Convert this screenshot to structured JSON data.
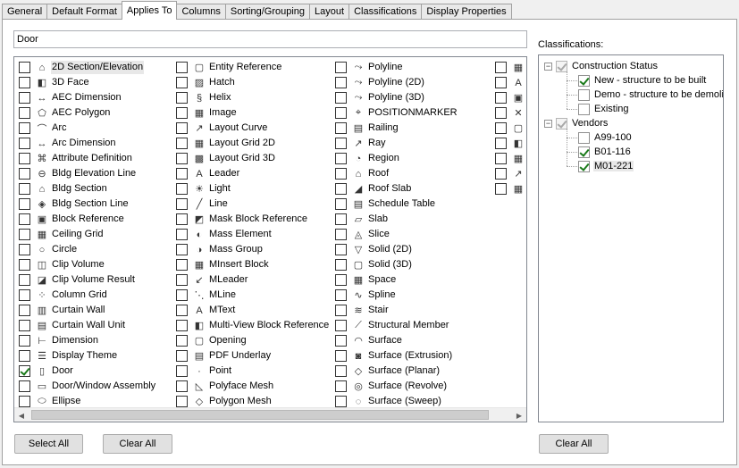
{
  "tabs": [
    "General",
    "Default Format",
    "Applies To",
    "Columns",
    "Sorting/Grouping",
    "Layout",
    "Classifications",
    "Display Properties"
  ],
  "active_tab": "Applies To",
  "filter": {
    "value": "Door"
  },
  "object_columns": [
    [
      {
        "label": "2D Section/Elevation",
        "icon": "section-elevation-icon",
        "checked": false,
        "selected": true
      },
      {
        "label": "3D Face",
        "icon": "face-icon",
        "checked": false
      },
      {
        "label": "AEC Dimension",
        "icon": "dimension-icon",
        "checked": false
      },
      {
        "label": "AEC Polygon",
        "icon": "polygon-icon",
        "checked": false
      },
      {
        "label": "Arc",
        "icon": "arc-icon",
        "checked": false
      },
      {
        "label": "Arc Dimension",
        "icon": "arc-dimension-icon",
        "checked": false
      },
      {
        "label": "Attribute Definition",
        "icon": "attribute-icon",
        "checked": false
      },
      {
        "label": "Bldg Elevation Line",
        "icon": "elevation-line-icon",
        "checked": false
      },
      {
        "label": "Bldg Section",
        "icon": "bldg-section-icon",
        "checked": false
      },
      {
        "label": "Bldg Section Line",
        "icon": "section-line-icon",
        "checked": false
      },
      {
        "label": "Block Reference",
        "icon": "block-icon",
        "checked": false
      },
      {
        "label": "Ceiling Grid",
        "icon": "ceiling-grid-icon",
        "checked": false
      },
      {
        "label": "Circle",
        "icon": "circle-icon",
        "checked": false
      },
      {
        "label": "Clip Volume",
        "icon": "clip-volume-icon",
        "checked": false
      },
      {
        "label": "Clip Volume Result",
        "icon": "clip-result-icon",
        "checked": false
      },
      {
        "label": "Column Grid",
        "icon": "column-grid-icon",
        "checked": false
      },
      {
        "label": "Curtain Wall",
        "icon": "curtain-wall-icon",
        "checked": false
      },
      {
        "label": "Curtain Wall Unit",
        "icon": "curtain-unit-icon",
        "checked": false
      },
      {
        "label": "Dimension",
        "icon": "linear-dimension-icon",
        "checked": false
      },
      {
        "label": "Display Theme",
        "icon": "display-theme-icon",
        "checked": false
      },
      {
        "label": "Door",
        "icon": "door-icon",
        "checked": true
      },
      {
        "label": "Door/Window Assembly",
        "icon": "assembly-icon",
        "checked": false
      },
      {
        "label": "Ellipse",
        "icon": "ellipse-icon",
        "checked": false
      }
    ],
    [
      {
        "label": "Entity Reference",
        "icon": "entity-ref-icon",
        "checked": false
      },
      {
        "label": "Hatch",
        "icon": "hatch-icon",
        "checked": false
      },
      {
        "label": "Helix",
        "icon": "helix-icon",
        "checked": false
      },
      {
        "label": "Image",
        "icon": "image-icon",
        "checked": false
      },
      {
        "label": "Layout Curve",
        "icon": "layout-curve-icon",
        "checked": false
      },
      {
        "label": "Layout Grid 2D",
        "icon": "grid-2d-icon",
        "checked": false
      },
      {
        "label": "Layout Grid 3D",
        "icon": "grid-3d-icon",
        "checked": false
      },
      {
        "label": "Leader",
        "icon": "leader-icon",
        "checked": false
      },
      {
        "label": "Light",
        "icon": "light-icon",
        "checked": false
      },
      {
        "label": "Line",
        "icon": "line-icon",
        "checked": false
      },
      {
        "label": "Mask Block Reference",
        "icon": "mask-block-icon",
        "checked": false
      },
      {
        "label": "Mass Element",
        "icon": "mass-element-icon",
        "checked": false
      },
      {
        "label": "Mass Group",
        "icon": "mass-group-icon",
        "checked": false
      },
      {
        "label": "MInsert Block",
        "icon": "minsert-icon",
        "checked": false
      },
      {
        "label": "MLeader",
        "icon": "mleader-icon",
        "checked": false
      },
      {
        "label": "MLine",
        "icon": "mline-icon",
        "checked": false
      },
      {
        "label": "MText",
        "icon": "mtext-icon",
        "checked": false
      },
      {
        "label": "Multi-View Block Reference",
        "icon": "mvblock-icon",
        "checked": false
      },
      {
        "label": "Opening",
        "icon": "opening-icon",
        "checked": false
      },
      {
        "label": "PDF Underlay",
        "icon": "pdf-icon",
        "checked": false
      },
      {
        "label": "Point",
        "icon": "point-icon",
        "checked": false
      },
      {
        "label": "Polyface Mesh",
        "icon": "polyface-icon",
        "checked": false
      },
      {
        "label": "Polygon Mesh",
        "icon": "polygon-mesh-icon",
        "checked": false
      }
    ],
    [
      {
        "label": "Polyline",
        "icon": "polyline-icon",
        "checked": false
      },
      {
        "label": "Polyline (2D)",
        "icon": "polyline-2d-icon",
        "checked": false
      },
      {
        "label": "Polyline (3D)",
        "icon": "polyline-3d-icon",
        "checked": false
      },
      {
        "label": "POSITIONMARKER",
        "icon": "position-marker-icon",
        "checked": false
      },
      {
        "label": "Railing",
        "icon": "railing-icon",
        "checked": false
      },
      {
        "label": "Ray",
        "icon": "ray-icon",
        "checked": false
      },
      {
        "label": "Region",
        "icon": "region-icon",
        "checked": false
      },
      {
        "label": "Roof",
        "icon": "roof-icon",
        "checked": false
      },
      {
        "label": "Roof Slab",
        "icon": "roof-slab-icon",
        "checked": false
      },
      {
        "label": "Schedule Table",
        "icon": "schedule-table-icon",
        "checked": false
      },
      {
        "label": "Slab",
        "icon": "slab-icon",
        "checked": false
      },
      {
        "label": "Slice",
        "icon": "slice-icon",
        "checked": false
      },
      {
        "label": "Solid (2D)",
        "icon": "solid-2d-icon",
        "checked": false
      },
      {
        "label": "Solid (3D)",
        "icon": "solid-3d-icon",
        "checked": false
      },
      {
        "label": "Space",
        "icon": "space-icon",
        "checked": false
      },
      {
        "label": "Spline",
        "icon": "spline-icon",
        "checked": false
      },
      {
        "label": "Stair",
        "icon": "stair-icon",
        "checked": false
      },
      {
        "label": "Structural Member",
        "icon": "structural-member-icon",
        "checked": false
      },
      {
        "label": "Surface",
        "icon": "surface-icon",
        "checked": false
      },
      {
        "label": "Surface (Extrusion)",
        "icon": "surface-extrusion-icon",
        "checked": false
      },
      {
        "label": "Surface (Planar)",
        "icon": "surface-planar-icon",
        "checked": false
      },
      {
        "label": "Surface (Revolve)",
        "icon": "surface-revolve-icon",
        "checked": false
      },
      {
        "label": "Surface (Sweep)",
        "icon": "surface-sweep-icon",
        "checked": false
      }
    ],
    [
      {
        "label": "",
        "icon": "table-icon",
        "checked": false
      },
      {
        "label": "",
        "icon": "text-icon",
        "checked": false
      },
      {
        "label": "",
        "icon": "tool-icon",
        "checked": false
      },
      {
        "label": "",
        "icon": "trace-icon",
        "checked": false
      },
      {
        "label": "",
        "icon": "viewport-icon",
        "checked": false
      },
      {
        "label": "",
        "icon": "wall-icon",
        "checked": false
      },
      {
        "label": "",
        "icon": "window-icon",
        "checked": false
      },
      {
        "label": "",
        "icon": "xline-icon",
        "checked": false
      },
      {
        "label": "",
        "icon": "zone-icon",
        "checked": false
      }
    ]
  ],
  "buttons": {
    "select_all": "Select All",
    "clear_all_left": "Clear All",
    "clear_all_right": "Clear All"
  },
  "classifications": {
    "label": "Classifications:",
    "groups": [
      {
        "label": "Construction Status",
        "children": [
          {
            "label": "New - structure to be built",
            "checked": true
          },
          {
            "label": "Demo - structure to be demolis",
            "checked": false
          },
          {
            "label": "Existing",
            "checked": false
          }
        ]
      },
      {
        "label": "Vendors",
        "children": [
          {
            "label": "A99-100",
            "checked": false
          },
          {
            "label": "B01-116",
            "checked": true
          },
          {
            "label": "M01-221",
            "checked": true,
            "selected": true
          }
        ]
      }
    ]
  }
}
